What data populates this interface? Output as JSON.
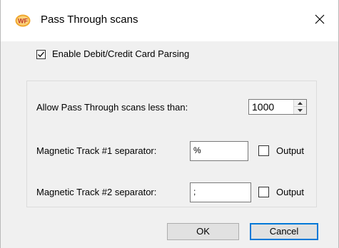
{
  "window": {
    "title": "Pass Through scans",
    "app_icon": "wf-logo",
    "app_icon_text": "WF",
    "close_icon": "close-icon"
  },
  "options": {
    "enable_parsing_label": "Enable Debit/Credit Card Parsing",
    "enable_parsing_checked": true
  },
  "group": {
    "threshold_label": "Allow Pass Through scans less than:",
    "threshold_value": "1000",
    "track1_label": "Magnetic Track #1 separator:",
    "track1_value": "%",
    "track1_output_label": "Output",
    "track1_output_checked": false,
    "track2_label": "Magnetic Track #2 separator:",
    "track2_value": ";",
    "track2_output_label": "Output",
    "track2_output_checked": false
  },
  "buttons": {
    "ok_label": "OK",
    "cancel_label": "Cancel"
  },
  "colors": {
    "accent": "#0078d7",
    "logo_bg": "#f0a830",
    "logo_text": "#c0392b"
  }
}
